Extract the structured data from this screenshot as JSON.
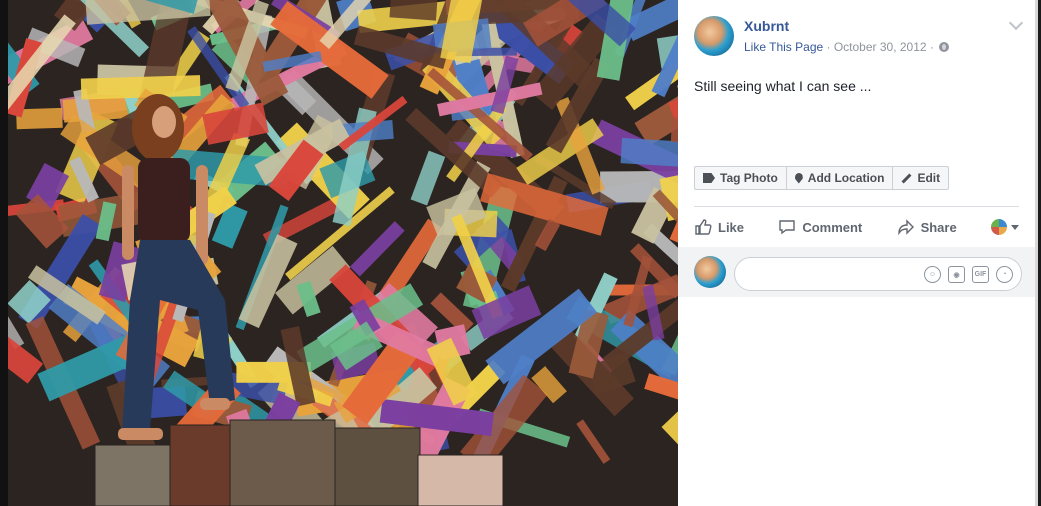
{
  "photo": {
    "description_icon": "artwork-photo"
  },
  "post": {
    "author": "Xubrnt",
    "like_page": "Like This Page",
    "separator": " · ",
    "date": "October 30, 2012",
    "caption": "Still seeing what I can see ..."
  },
  "photo_actions": {
    "tag": "Tag Photo",
    "location": "Add Location",
    "edit": "Edit"
  },
  "social": {
    "like": "Like",
    "comment": "Comment",
    "share": "Share"
  },
  "comment": {
    "placeholder": ""
  },
  "colors": {
    "link": "#365899",
    "meta": "#90949c",
    "text": "#1d2129"
  }
}
